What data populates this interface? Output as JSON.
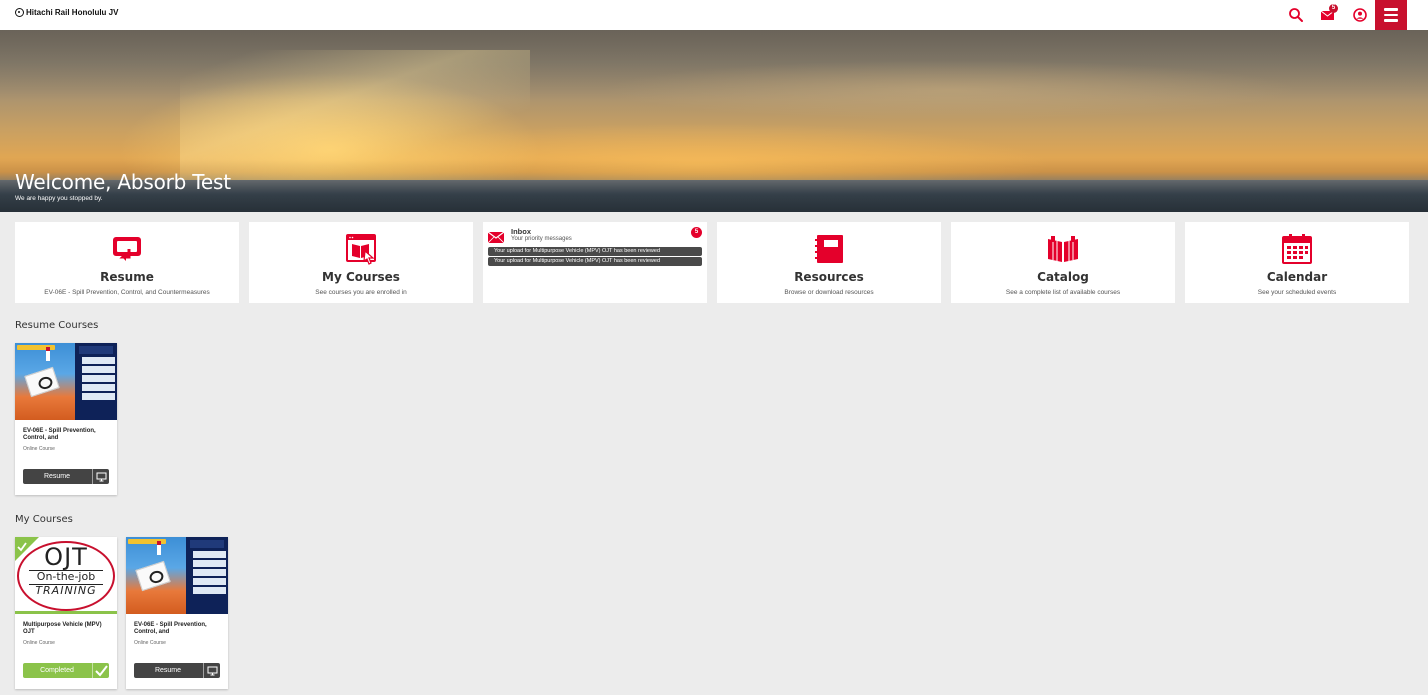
{
  "header": {
    "brand": "Hitachi Rail Honolulu JV",
    "mail_badge_count": "5",
    "icons": [
      "search-icon",
      "mail-icon",
      "user-account-icon",
      "hamburger-menu-icon"
    ]
  },
  "banner": {
    "welcome": "Welcome, Absorb Test",
    "subtitle": "We are happy you stopped by."
  },
  "tiles": [
    {
      "title": "Resume",
      "subtitle": "EV-06E - Spill Prevention, Control, and Countermeasures",
      "icon": "resume-icon"
    },
    {
      "title": "My Courses",
      "subtitle": "See courses you are enrolled in",
      "icon": "my-courses-icon"
    },
    {
      "title": "Resources",
      "subtitle": "Browse or download resources",
      "icon": "resources-icon"
    },
    {
      "title": "Catalog",
      "subtitle": "See a complete list of available courses",
      "icon": "catalog-icon"
    },
    {
      "title": "Calendar",
      "subtitle": "See your scheduled events",
      "icon": "calendar-icon"
    }
  ],
  "inbox": {
    "title": "Inbox",
    "subtitle": "Your priority messages",
    "badge": "5",
    "messages": [
      "Your upload for Multipurpose Vehicle (MPV) OJT has been reviewed",
      "Your upload for Multipurpose Vehicle (MPV) OJT has been reviewed"
    ]
  },
  "sections": {
    "resume_courses": "Resume Courses",
    "my_courses": "My Courses"
  },
  "resume_courses": [
    {
      "title": "EV-06E - Spill Prevention, Control, and",
      "type": "Online Course",
      "button": "Resume"
    }
  ],
  "my_courses": [
    {
      "title": "Multipurpose Vehicle (MPV) OJT",
      "type": "Online Course",
      "button": "Completed",
      "thumb_text": [
        "OJT",
        "On-the-job",
        "TRAINING"
      ]
    },
    {
      "title": "EV-06E - Spill Prevention, Control, and",
      "type": "Online Course",
      "button": "Resume"
    }
  ],
  "colors": {
    "accent": "#e4002b",
    "brand_red": "#c8102e",
    "completed_green": "#8bc34a",
    "button_dark": "#444444"
  }
}
